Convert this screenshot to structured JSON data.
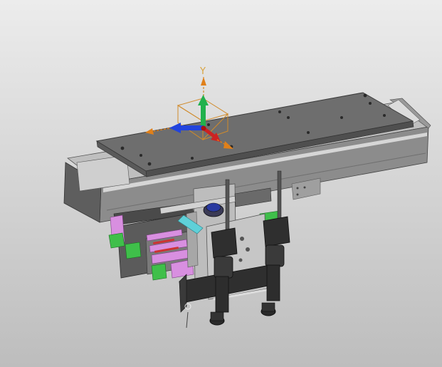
{
  "viewport": {
    "background_top": "#ececec",
    "background_bottom": "#bdbdbd"
  },
  "triad": {
    "y_label": "Y",
    "y_color": "#d9a441",
    "x_color": "#e0801a",
    "z_color": "#e0801a",
    "y_arrow_color": "#22b14c",
    "x_arrow_color": "#2244dd",
    "z_arrow_color": "#cc2222"
  },
  "colors": {
    "plate_top": "#6d6d6d",
    "plate_edge": "#4f4f4f",
    "rail_body": "#8a8a8a",
    "rail_side": "#5c5c5c",
    "rail_light": "#d6d6d6",
    "green_parts": "#3fbf4a",
    "pink_parts": "#d88fe0",
    "cyan_part": "#5fd0d8",
    "dark_parts": "#2f2f2f"
  }
}
